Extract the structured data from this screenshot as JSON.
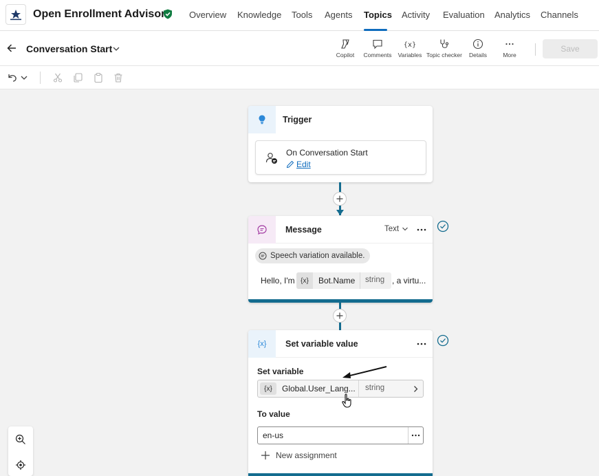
{
  "app": {
    "title": "Open Enrollment Advisor",
    "logo_icon": "org-logo",
    "verified_icon": "shield-check-icon"
  },
  "nav": {
    "tabs": [
      {
        "label": "Overview"
      },
      {
        "label": "Knowledge"
      },
      {
        "label": "Tools"
      },
      {
        "label": "Agents"
      },
      {
        "label": "Topics",
        "active": true
      },
      {
        "label": "Activity"
      },
      {
        "label": "Evaluation"
      },
      {
        "label": "Analytics"
      },
      {
        "label": "Channels"
      }
    ]
  },
  "topic": {
    "title": "Conversation Start"
  },
  "toolbar": {
    "items": [
      {
        "label": "Copilot",
        "icon": "copilot-icon"
      },
      {
        "label": "Comments",
        "icon": "comment-icon"
      },
      {
        "label": "Variables",
        "icon": "variables-icon"
      },
      {
        "label": "Topic checker",
        "icon": "stethoscope-icon"
      },
      {
        "label": "Details",
        "icon": "info-icon"
      },
      {
        "label": "More",
        "icon": "more-icon"
      }
    ],
    "save_label": "Save"
  },
  "canvas": {
    "trigger": {
      "title": "Trigger",
      "event_label": "On Conversation Start",
      "edit_label": "Edit"
    },
    "message": {
      "title": "Message",
      "format_label": "Text",
      "speech_pill": "Speech variation available.",
      "text_prefix": "Hello, I'm",
      "var_tag": "{x}",
      "var_name": "Bot.Name",
      "var_type": "string",
      "text_suffix": ", a virtu..."
    },
    "set_variable": {
      "title": "Set variable value",
      "title_icon": "{x}",
      "set_label": "Set variable",
      "var_tag": "{x}",
      "var_name": "Global.User_Lang...",
      "var_type": "string",
      "to_value_label": "To value",
      "value": "en-us",
      "new_assignment_label": "New assignment"
    }
  },
  "colors": {
    "accent": "#0f6cbd",
    "connector": "#146c8f",
    "verified": "#107c41"
  }
}
